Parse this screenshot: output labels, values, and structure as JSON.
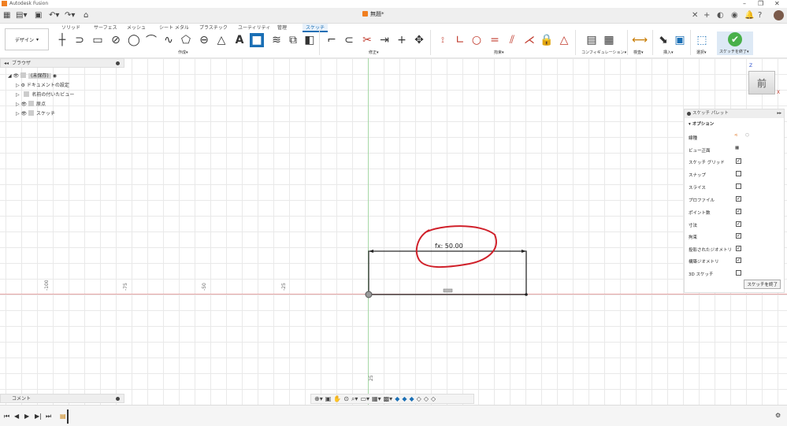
{
  "window": {
    "title": "Autodesk Fusion",
    "document_tab": "無題*"
  },
  "ribbon": {
    "design_button": "デザイン",
    "tabs": [
      "ソリッド",
      "サーフェス",
      "メッシュ",
      "シート メタル",
      "プラスチック",
      "ユーティリティ",
      "管理",
      "スケッチ"
    ],
    "active_tab": "スケッチ",
    "groups": {
      "create": "作成",
      "modify": "修正",
      "constraints": "拘束",
      "configure": "コンフィギュレーション",
      "inspect": "検査",
      "insert": "挿入",
      "select": "選択",
      "finish_sketch": "スケッチを終了"
    }
  },
  "browser": {
    "title": "ブラウザ",
    "root": "(未保存)",
    "items": [
      "ドキュメントの設定",
      "名前の付いたビュー",
      "原点",
      "スケッチ"
    ]
  },
  "sketch_palette": {
    "title": "スケッチ パレット",
    "section": "オプション",
    "rows": [
      {
        "label": "線種",
        "type": "icons"
      },
      {
        "label": "ビュー正面",
        "type": "icon"
      },
      {
        "label": "スケッチ グリッド",
        "checked": true
      },
      {
        "label": "スナップ",
        "checked": false
      },
      {
        "label": "スライス",
        "checked": false
      },
      {
        "label": "プロファイル",
        "checked": true
      },
      {
        "label": "ポイント数",
        "checked": true
      },
      {
        "label": "寸法",
        "checked": true
      },
      {
        "label": "拘束",
        "checked": true
      },
      {
        "label": "投影されたジオメトリ",
        "checked": true
      },
      {
        "label": "構築ジオメトリ",
        "checked": true
      },
      {
        "label": "3D スケッチ",
        "checked": false
      }
    ],
    "finish_button": "スケッチを終了"
  },
  "viewcube": {
    "face": "前",
    "axis_z": "Z",
    "axis_x": "X"
  },
  "canvas": {
    "dimension_text": "fx: 50.00",
    "axis_labels": [
      "-100",
      "-75",
      "-50",
      "-25",
      "25"
    ]
  },
  "comments": {
    "title": "コメント"
  },
  "colors": {
    "accent": "#1a6fb5",
    "finish_green": "#49b04a",
    "annotation_red": "#d0202a",
    "x_axis": "#e7a6a6",
    "y_axis": "#a6d8a6"
  }
}
